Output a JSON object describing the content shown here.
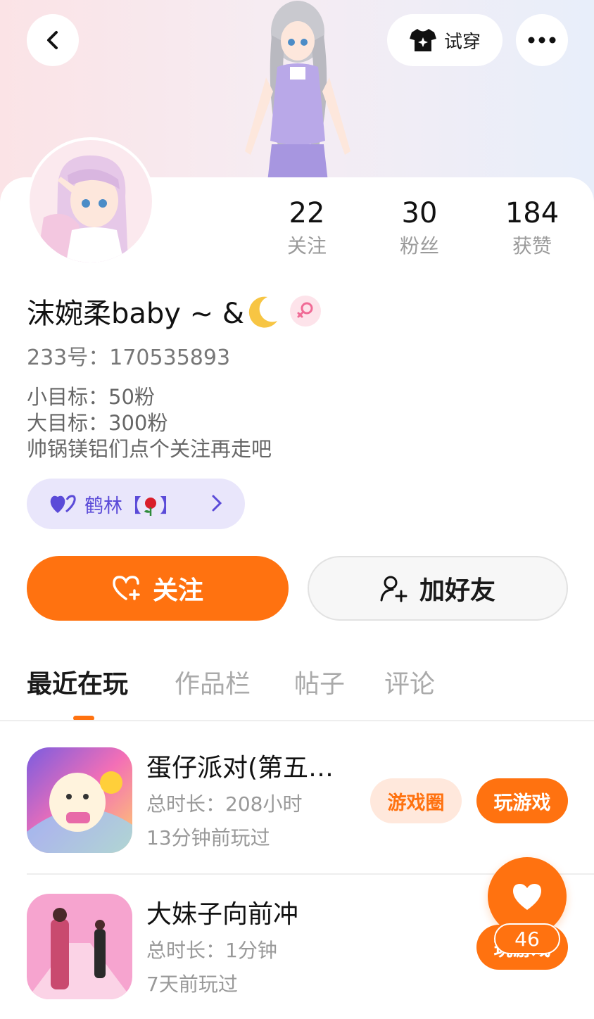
{
  "header": {
    "back_icon": "chevron-left-icon",
    "try_on_label": "试穿",
    "try_on_icon": "tshirt-sparkle-icon",
    "more_icon": "more-dots-icon"
  },
  "profile": {
    "stats": [
      {
        "value": "22",
        "label": "关注"
      },
      {
        "value": "30",
        "label": "粉丝"
      },
      {
        "value": "184",
        "label": "获赞"
      }
    ],
    "nickname": "沫婉柔baby ~ &",
    "gender_icon": "female-icon",
    "uid": "233号：170535893",
    "bio": [
      "小目标：50粉",
      "大目标：300粉",
      "帅锅镁铝们点个关注再走吧"
    ],
    "group": {
      "name": "鹤林【",
      "name_end": "】",
      "icon": "heart-pair-icon",
      "emoji_icon": "rose-icon"
    }
  },
  "actions": {
    "follow_label": "关注",
    "add_friend_label": "加好友"
  },
  "tabs": [
    {
      "label": "最近在玩",
      "active": true
    },
    {
      "label": "作品栏",
      "active": false
    },
    {
      "label": "帖子",
      "active": false
    },
    {
      "label": "评论",
      "active": false
    }
  ],
  "games": [
    {
      "title": "蛋仔派对(第五…",
      "duration": "总时长：208小时",
      "last_played": "13分钟前玩过",
      "circle_label": "游戏圈",
      "play_label": "玩游戏"
    },
    {
      "title": "大妹子向前冲",
      "duration": "总时长：1分钟",
      "last_played": "7天前玩过",
      "play_label": "玩游戏"
    }
  ],
  "like_fab": {
    "count": "46",
    "icon": "heart-icon"
  },
  "colors": {
    "accent": "#ff7210",
    "group_bg": "#e9e6fb",
    "group_text": "#5b4bd8",
    "circle_bg": "#ffe8dc"
  }
}
